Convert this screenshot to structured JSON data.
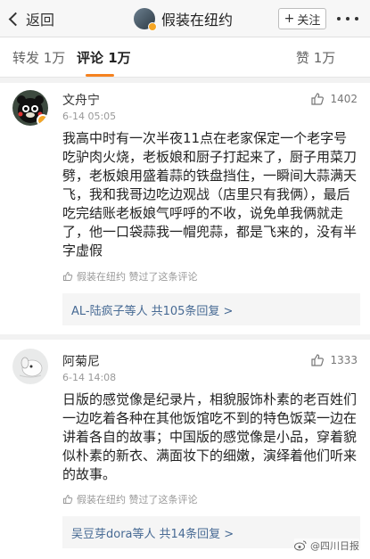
{
  "header": {
    "back_label": "返回",
    "title": "假装在纽约",
    "follow_label": "关注",
    "follow_plus": "+"
  },
  "tabs": [
    {
      "label": "转发 1万"
    },
    {
      "label": "评论 1万"
    },
    {
      "label": "赞 1万"
    }
  ],
  "comments": [
    {
      "user": "文舟宁",
      "date": "6-14 05:05",
      "likes": "1402",
      "text": "我高中时有一次半夜11点在老家保定一个老字号吃驴肉火烧，老板娘和厨子打起来了，厨子用菜刀劈，老板娘用盛着蒜的铁盘挡住，一瞬间大蒜满天飞，我和我哥边吃边观战（店里只有我俩），最后吃完结账老板娘气呼呼的不收，说免单我俩就走了，他一口袋蒜我一帽兜蒜，都是飞来的，没有半字虚假",
      "liked_by": "假装在纽约 赞过了这条评论",
      "replies": {
        "names": "AL-陆疯子等人",
        "count": "共105条回复 >"
      }
    },
    {
      "user": "阿菊尼",
      "date": "6-14 14:08",
      "likes": "1333",
      "text": "日版的感觉像是纪录片，相貌服饰朴素的老百姓们一边吃着各种在其他饭馆吃不到的特色饭菜一边在讲着各自的故事；中国版的感觉像是小品，穿着貌似朴素的新衣、满面妆下的细嫩，演绎着他们听来的故事。",
      "liked_by": "假装在纽约 赞过了这条评论",
      "replies": {
        "names": "吴豆芽dora等人",
        "count": "共14条回复 >"
      }
    }
  ],
  "watermark": "@四川日报",
  "colors": {
    "accent": "#f5821f",
    "link": "#476a94",
    "verified": "#f6a623"
  }
}
